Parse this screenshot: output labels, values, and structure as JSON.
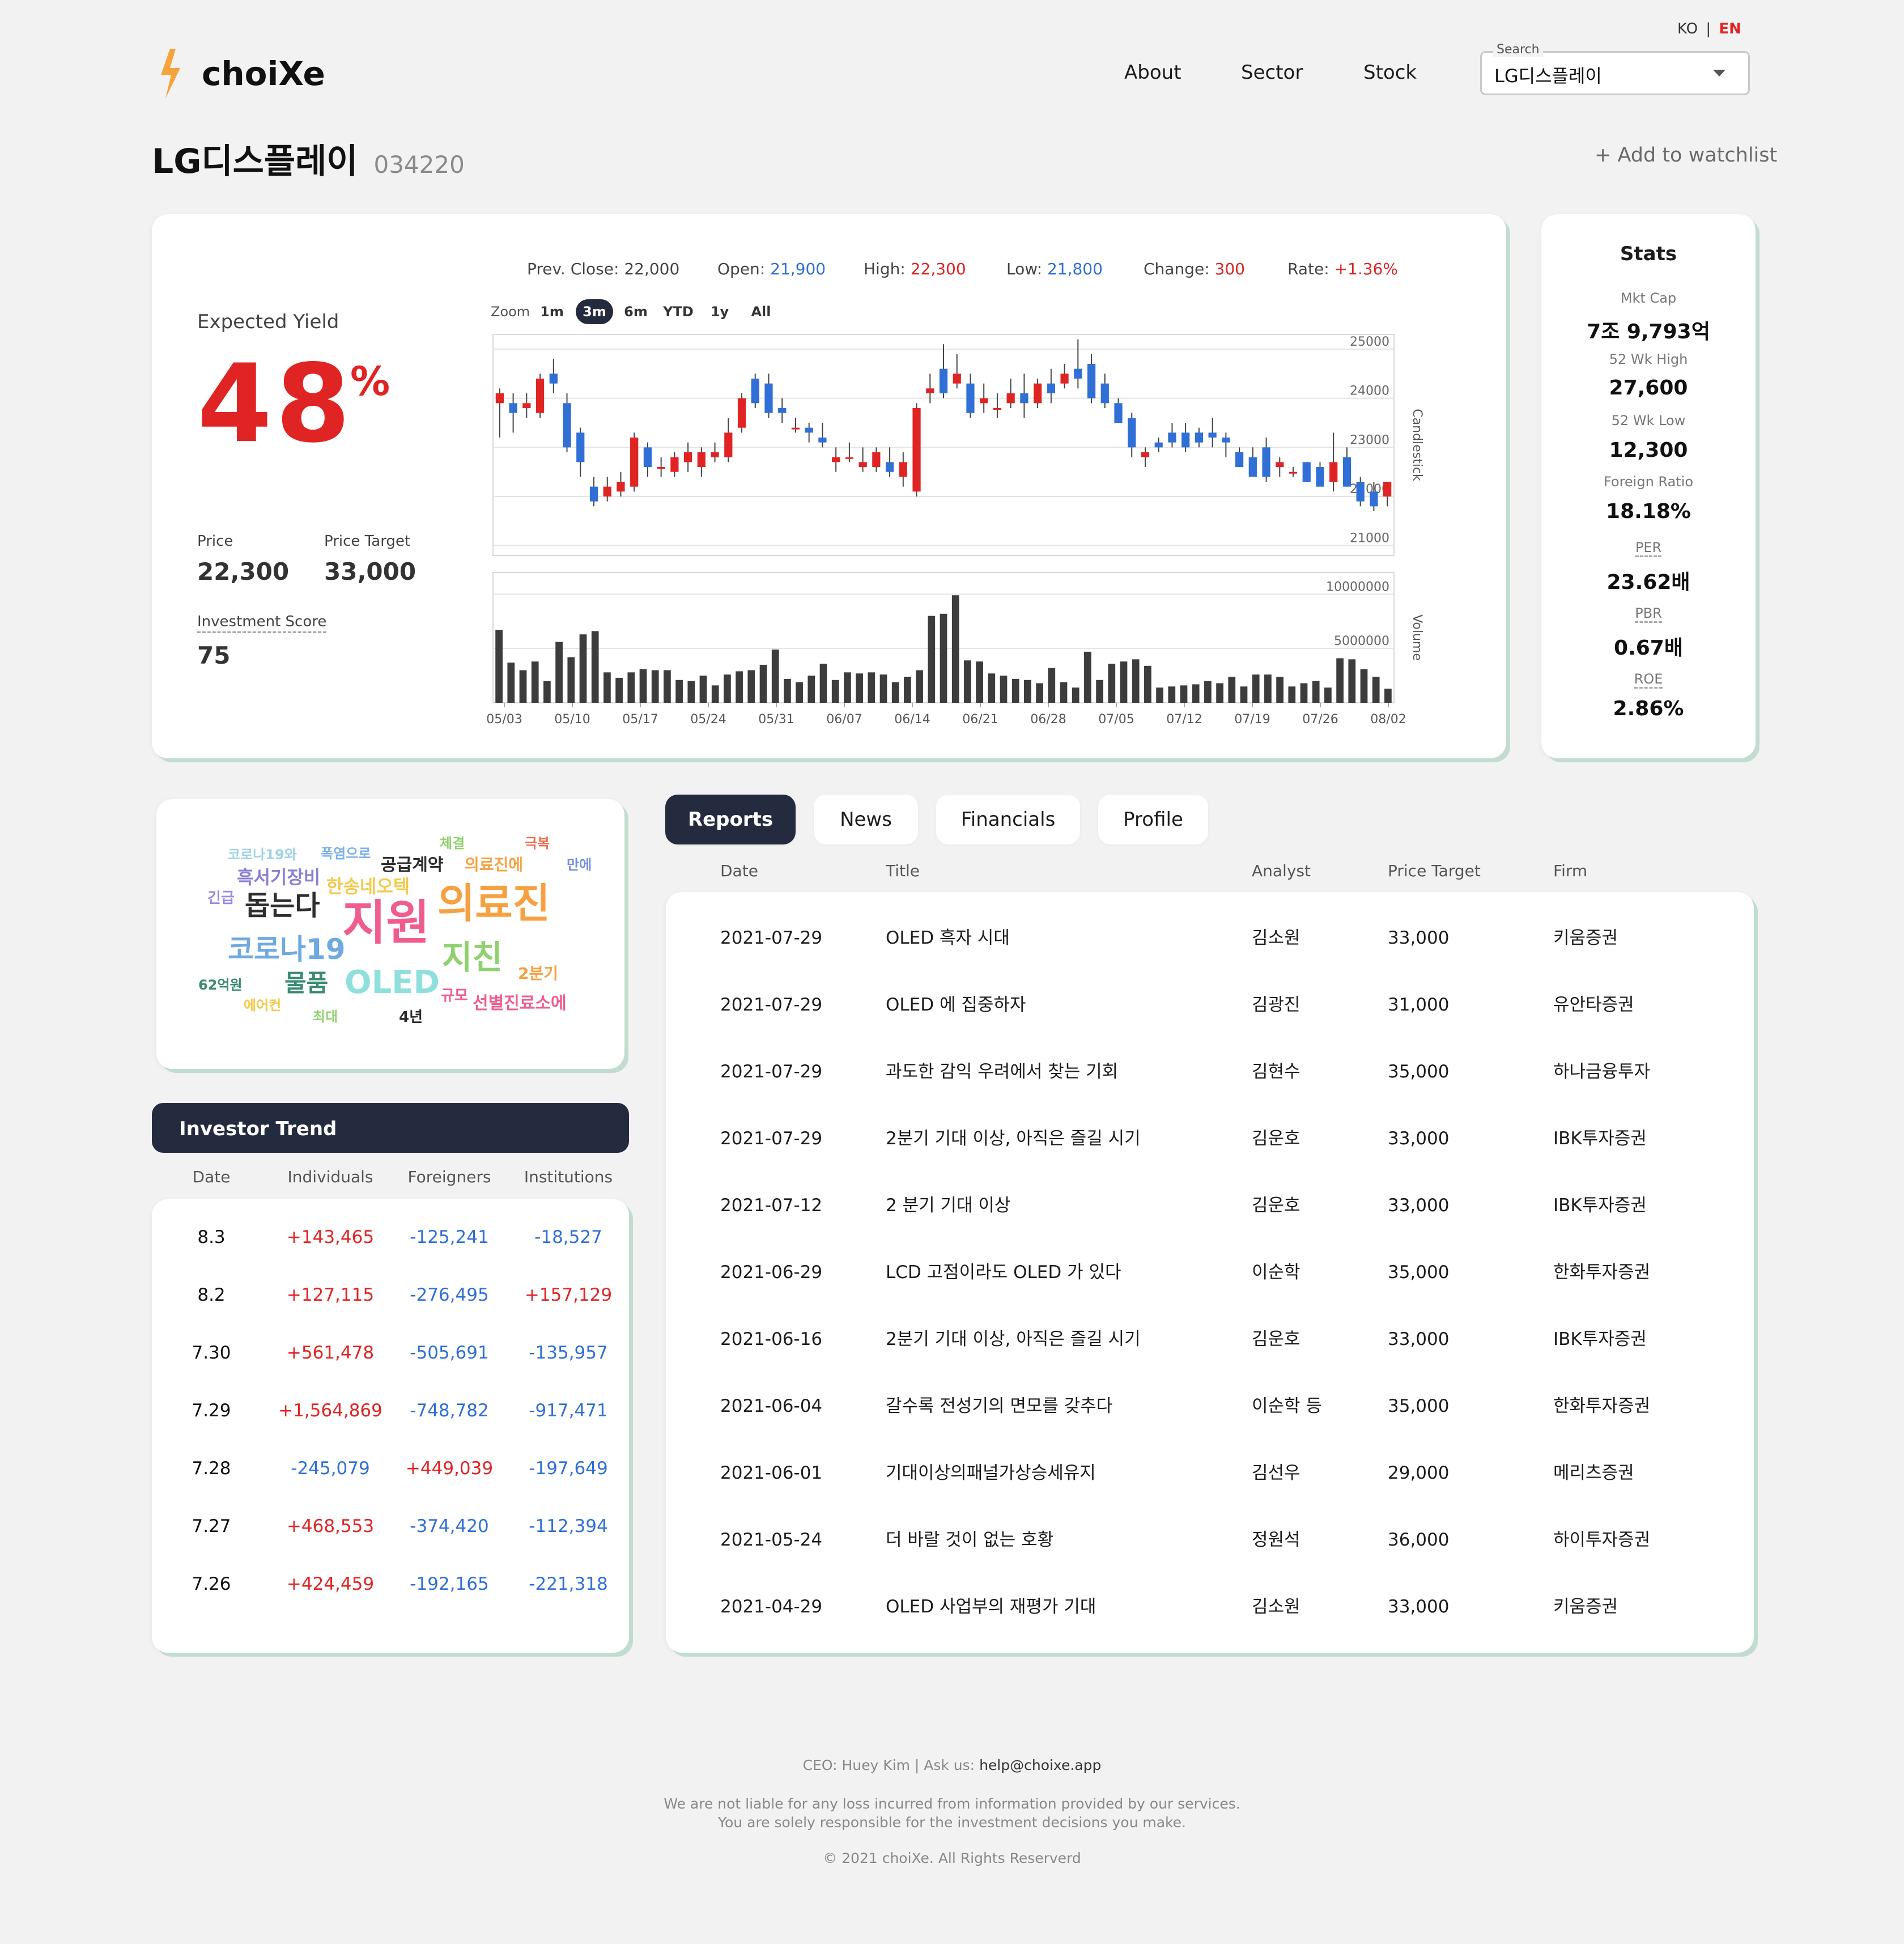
{
  "lang": {
    "ko": "KO",
    "sep": "|",
    "en": "EN"
  },
  "header": {
    "brand": "choiXe",
    "nav": [
      "About",
      "Sector",
      "Stock"
    ],
    "search": {
      "label": "Search",
      "value": "LG디스플레이"
    }
  },
  "company": {
    "name": "LG디스플레이",
    "code": "034220",
    "watchlist": "+ Add to watchlist"
  },
  "summary": {
    "expected_yield_label": "Expected Yield",
    "expected_yield": "48",
    "percent": "%",
    "price_label": "Price",
    "price": "22,300",
    "target_label": "Price Target",
    "target": "33,000",
    "score_label": "Investment Score",
    "score": "75"
  },
  "quote": {
    "prev_close_label": "Prev. Close:",
    "prev_close": "22,000",
    "open_label": "Open:",
    "open": "21,900",
    "high_label": "High:",
    "high": "22,300",
    "low_label": "Low:",
    "low": "21,800",
    "change_label": "Change:",
    "change": "300",
    "rate_label": "Rate:",
    "rate": "+1.36%"
  },
  "zoom": {
    "label": "Zoom",
    "options": [
      "1m",
      "3m",
      "6m",
      "YTD",
      "1y",
      "All"
    ],
    "selected": "3m"
  },
  "colors": {
    "up": "#e02424",
    "down": "#2f6fd6",
    "navy": "#252b3e",
    "volume": "#3c3c3c"
  },
  "chart_data": [
    {
      "type": "candlestick",
      "ylabel": "Candlestick",
      "yticks": [
        25000,
        24000,
        23000,
        22000,
        21000
      ],
      "ylim": [
        20800,
        25300
      ],
      "xticks": [
        "05/03",
        "05/10",
        "05/17",
        "05/24",
        "05/31",
        "06/07",
        "06/14",
        "06/21",
        "06/28",
        "07/05",
        "07/12",
        "07/19",
        "07/26",
        "08/02"
      ],
      "ohlc": [
        [
          23900,
          24200,
          23200,
          24100
        ],
        [
          23900,
          24100,
          23300,
          23700
        ],
        [
          23800,
          24100,
          23600,
          23900
        ],
        [
          23700,
          24500,
          23600,
          24400
        ],
        [
          24500,
          24800,
          24100,
          24300
        ],
        [
          23900,
          24100,
          22900,
          23000
        ],
        [
          23300,
          23400,
          22400,
          22700
        ],
        [
          22200,
          22400,
          21800,
          21900
        ],
        [
          22000,
          22400,
          21900,
          22200
        ],
        [
          22100,
          22500,
          22000,
          22300
        ],
        [
          22200,
          23300,
          22100,
          23200
        ],
        [
          23000,
          23100,
          22400,
          22600
        ],
        [
          22600,
          22800,
          22400,
          22600
        ],
        [
          22500,
          22900,
          22400,
          22800
        ],
        [
          22700,
          23100,
          22500,
          22900
        ],
        [
          22600,
          23000,
          22400,
          22900
        ],
        [
          22800,
          23100,
          22700,
          22900
        ],
        [
          22800,
          23600,
          22700,
          23300
        ],
        [
          23400,
          24100,
          23300,
          24000
        ],
        [
          24400,
          24500,
          23800,
          23900
        ],
        [
          24300,
          24500,
          23600,
          23700
        ],
        [
          23800,
          24000,
          23500,
          23700
        ],
        [
          23400,
          23600,
          23300,
          23400
        ],
        [
          23400,
          23500,
          23100,
          23300
        ],
        [
          23200,
          23500,
          23000,
          23100
        ],
        [
          22700,
          23000,
          22500,
          22800
        ],
        [
          22800,
          23100,
          22700,
          22800
        ],
        [
          22600,
          23000,
          22500,
          22700
        ],
        [
          22600,
          23000,
          22500,
          22900
        ],
        [
          22700,
          23000,
          22400,
          22500
        ],
        [
          22400,
          22900,
          22200,
          22700
        ],
        [
          22100,
          23900,
          22000,
          23800
        ],
        [
          24100,
          24500,
          23900,
          24200
        ],
        [
          24600,
          25100,
          24000,
          24100
        ],
        [
          24300,
          24900,
          24200,
          24500
        ],
        [
          24300,
          24500,
          23600,
          23700
        ],
        [
          23900,
          24300,
          23700,
          24000
        ],
        [
          23800,
          24100,
          23600,
          23800
        ],
        [
          23900,
          24400,
          23800,
          24100
        ],
        [
          24100,
          24500,
          23600,
          23900
        ],
        [
          23900,
          24400,
          23800,
          24300
        ],
        [
          24300,
          24600,
          23900,
          24100
        ],
        [
          24300,
          24700,
          24200,
          24500
        ],
        [
          24600,
          25200,
          24200,
          24400
        ],
        [
          24700,
          24900,
          23900,
          24000
        ],
        [
          24300,
          24500,
          23800,
          23900
        ],
        [
          23900,
          24000,
          23500,
          23500
        ],
        [
          23600,
          23700,
          22800,
          23000
        ],
        [
          22800,
          23000,
          22600,
          22900
        ],
        [
          23100,
          23200,
          22900,
          23000
        ],
        [
          23300,
          23500,
          23000,
          23100
        ],
        [
          23300,
          23500,
          22900,
          23000
        ],
        [
          23300,
          23400,
          23000,
          23100
        ],
        [
          23300,
          23600,
          23000,
          23200
        ],
        [
          23200,
          23300,
          22800,
          23100
        ],
        [
          22900,
          23000,
          22600,
          22600
        ],
        [
          22800,
          23000,
          22600,
          22400
        ],
        [
          23000,
          23200,
          22300,
          22400
        ],
        [
          22600,
          22800,
          22400,
          22700
        ],
        [
          22500,
          22600,
          22400,
          22500
        ],
        [
          22700,
          22700,
          22300,
          22300
        ],
        [
          22600,
          22700,
          22300,
          22200
        ],
        [
          22300,
          23300,
          22100,
          22700
        ],
        [
          22800,
          23000,
          22200,
          22200
        ],
        [
          22300,
          22400,
          21800,
          21900
        ],
        [
          22100,
          22300,
          21700,
          21800
        ],
        [
          22000,
          22300,
          21800,
          22300
        ]
      ]
    },
    {
      "type": "bar",
      "ylabel": "Volume",
      "yticks": [
        10000000,
        5000000
      ],
      "values": [
        6700000,
        3700000,
        3000000,
        3800000,
        2000000,
        5600000,
        4200000,
        6300000,
        6600000,
        2800000,
        2300000,
        2800000,
        3100000,
        3000000,
        3000000,
        2100000,
        2000000,
        2500000,
        1600000,
        2600000,
        2900000,
        3000000,
        3500000,
        4900000,
        2200000,
        1900000,
        2500000,
        3600000,
        2100000,
        2800000,
        2700000,
        2800000,
        2600000,
        1900000,
        2400000,
        3000000,
        8000000,
        8200000,
        9900000,
        3900000,
        3800000,
        2700000,
        2500000,
        2200000,
        2100000,
        1800000,
        3200000,
        1900000,
        1400000,
        4700000,
        2100000,
        3600000,
        3800000,
        4000000,
        3400000,
        1400000,
        1500000,
        1600000,
        1700000,
        2000000,
        1800000,
        2400000,
        1500000,
        2600000,
        2600000,
        2400000,
        1500000,
        1800000,
        2000000,
        1400000,
        4100000,
        4000000,
        3100000,
        2400000,
        1300000
      ]
    }
  ],
  "stats": {
    "title": "Stats",
    "items": [
      {
        "label": "Mkt Cap",
        "value": "7조 9,793억"
      },
      {
        "label": "52 Wk High",
        "value": "27,600"
      },
      {
        "label": "52 Wk Low",
        "value": "12,300"
      },
      {
        "label": "Foreign Ratio",
        "value": "18.18%"
      },
      {
        "label": "PER",
        "value": "23.62배"
      },
      {
        "label": "PBR",
        "value": "0.67배"
      },
      {
        "label": "ROE",
        "value": "2.86%"
      }
    ]
  },
  "wordcloud": [
    {
      "text": "코로나19와",
      "color": "#9fd3e6"
    },
    {
      "text": "폭염으로",
      "color": "#7ab0e8"
    },
    {
      "text": "공급계약",
      "color": "#2d2d2d"
    },
    {
      "text": "체결",
      "color": "#8fd16f"
    },
    {
      "text": "극복",
      "color": "#f06a4a"
    },
    {
      "text": "의료진에",
      "color": "#f5a142"
    },
    {
      "text": "만에",
      "color": "#6f8fe0"
    },
    {
      "text": "흑서기장비",
      "color": "#8a7fd6"
    },
    {
      "text": "한송네오텍",
      "color": "#f3c94c"
    },
    {
      "text": "긴급",
      "color": "#9a8ae0"
    },
    {
      "text": "돕는다",
      "color": "#2d2d2d"
    },
    {
      "text": "지원",
      "color": "#ef5d8f"
    },
    {
      "text": "의료진",
      "color": "#f5a142"
    },
    {
      "text": "코로나19",
      "color": "#6eaae0"
    },
    {
      "text": "지친",
      "color": "#8fd16f"
    },
    {
      "text": "2분기",
      "color": "#f5a142"
    },
    {
      "text": "62억원",
      "color": "#3a8b72"
    },
    {
      "text": "물품",
      "color": "#3a8b72"
    },
    {
      "text": "OLED",
      "color": "#8fe0dc"
    },
    {
      "text": "규모",
      "color": "#ef5d8f"
    },
    {
      "text": "선별진료소에",
      "color": "#ef5d8f"
    },
    {
      "text": "에어컨",
      "color": "#f3c94c"
    },
    {
      "text": "최대",
      "color": "#8fd16f"
    },
    {
      "text": "4년",
      "color": "#2d2d2d"
    }
  ],
  "investor_trend": {
    "title": "Investor Trend",
    "columns": [
      "Date",
      "Individuals",
      "Foreigners",
      "Institutions"
    ],
    "rows": [
      [
        "8.3",
        "+143,465",
        "-125,241",
        "-18,527"
      ],
      [
        "8.2",
        "+127,115",
        "-276,495",
        "+157,129"
      ],
      [
        "7.30",
        "+561,478",
        "-505,691",
        "-135,957"
      ],
      [
        "7.29",
        "+1,564,869",
        "-748,782",
        "-917,471"
      ],
      [
        "7.28",
        "-245,079",
        "+449,039",
        "-197,649"
      ],
      [
        "7.27",
        "+468,553",
        "-374,420",
        "-112,394"
      ],
      [
        "7.26",
        "+424,459",
        "-192,165",
        "-221,318"
      ]
    ]
  },
  "tabs": [
    "Reports",
    "News",
    "Financials",
    "Profile"
  ],
  "reports": {
    "columns": [
      "Date",
      "Title",
      "Analyst",
      "Price Target",
      "Firm"
    ],
    "rows": [
      [
        "2021-07-29",
        "OLED 흑자 시대",
        "김소원",
        "33,000",
        "키움증권"
      ],
      [
        "2021-07-29",
        "OLED 에 집중하자",
        "김광진",
        "31,000",
        "유안타증권"
      ],
      [
        "2021-07-29",
        "과도한 감익 우려에서 찾는 기회",
        "김현수",
        "35,000",
        "하나금융투자"
      ],
      [
        "2021-07-29",
        "2분기 기대 이상, 아직은 즐길 시기",
        "김운호",
        "33,000",
        "IBK투자증권"
      ],
      [
        "2021-07-12",
        "2 분기 기대 이상",
        "김운호",
        "33,000",
        "IBK투자증권"
      ],
      [
        "2021-06-29",
        "LCD 고점이라도 OLED 가 있다",
        "이순학",
        "35,000",
        "한화투자증권"
      ],
      [
        "2021-06-16",
        "2분기 기대 이상, 아직은 즐길 시기",
        "김운호",
        "33,000",
        "IBK투자증권"
      ],
      [
        "2021-06-04",
        "갈수록 전성기의 면모를 갖추다",
        "이순학 등",
        "35,000",
        "한화투자증권"
      ],
      [
        "2021-06-01",
        "기대이상의패널가상승세유지",
        "김선우",
        "29,000",
        "메리츠증권"
      ],
      [
        "2021-05-24",
        "더 바랄 것이 없는 호황",
        "정원석",
        "36,000",
        "하이투자증권"
      ],
      [
        "2021-04-29",
        "OLED 사업부의 재평가 기대",
        "김소원",
        "33,000",
        "키움증권"
      ]
    ]
  },
  "footer": {
    "ceo": "CEO: Huey Kim | Ask us: ",
    "email": "help@choixe.app",
    "disclaimer1": "We are not liable for any loss incurred from information provided by our services.",
    "disclaimer2": "You are solely responsible for the investment decisions you make.",
    "copyright": "© 2021 choiXe. All Rights Reserverd"
  }
}
